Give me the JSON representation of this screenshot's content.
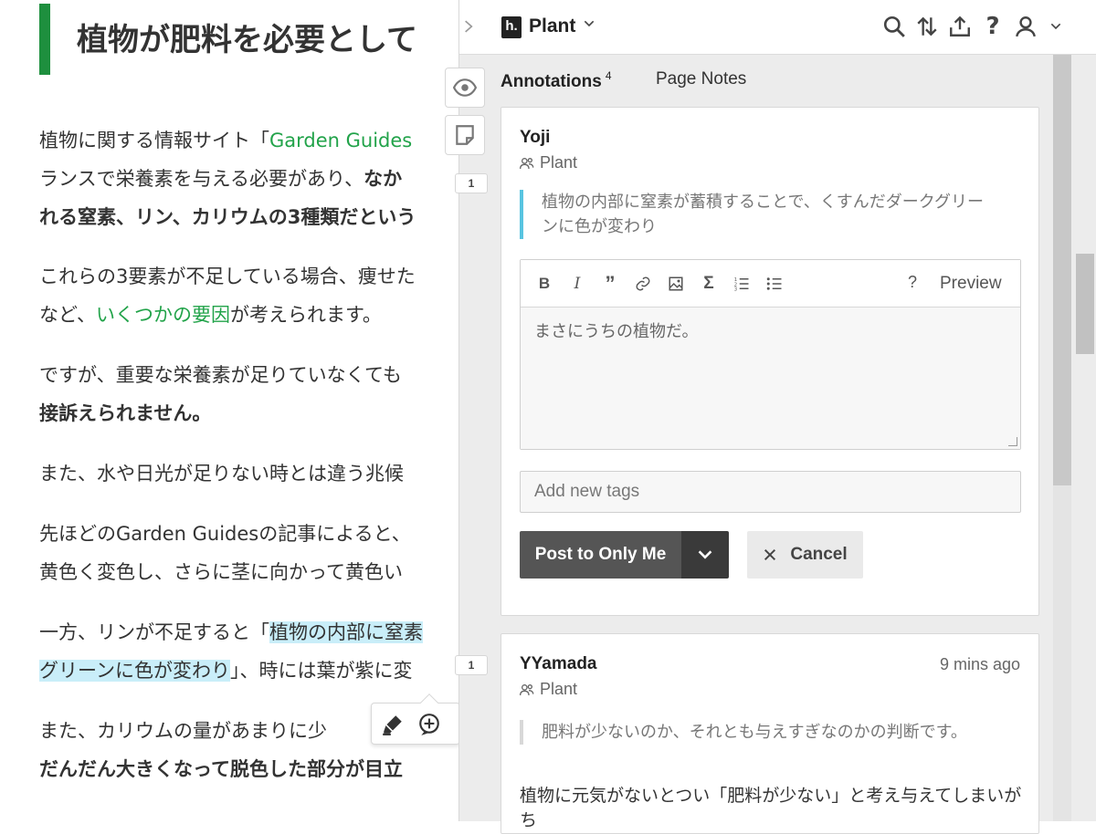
{
  "article": {
    "title": "植物が肥料を必要として",
    "p1_a": "植物に関する情報サイト「",
    "p1_link": "Garden Guides",
    "p1_b": "ランスで栄養素を与える必要があり、",
    "p1_c": "なか",
    "p1_d": "れる窒素、リン、カリウムの3種類だという",
    "p2_a": "これらの3要素が不足している場合、痩せた",
    "p2_b": "など、",
    "p2_link": "いくつかの要因",
    "p2_c": "が考えられます。",
    "p3_a": "ですが、重要な栄養素が足りていなくても",
    "p3_b": "接訴えられません。",
    "p4": "また、水や日光が足りない時とは違う兆候",
    "p5_a": "先ほどのGarden Guidesの記事によると、",
    "p5_b": "黄色く変色し、さらに茎に向かって黄色い",
    "p6_a": "一方、リンが不足すると「",
    "p6_hl1": "植物の内部に窒素",
    "p6_hl2": "グリーンに色が変わり",
    "p6_b": "」、時には葉が紫に変",
    "p7_a": "また、カリウムの量があまりに少",
    "p7_b": "だんだん大きくなって脱色した部分が目立"
  },
  "sidebar": {
    "group_name": "Plant",
    "logo_text": "h.",
    "tabs": {
      "annotations": "Annotations",
      "annotations_count": "4",
      "page_notes": "Page Notes"
    },
    "bucket_counts": [
      "1",
      "1"
    ]
  },
  "cards": [
    {
      "user": "Yoji",
      "group": "Plant",
      "quote": "植物の内部に窒素が蓄積することで、くすんだダークグリーンに色が変わり",
      "quote_color": "#58c4e0",
      "editor": {
        "text": "まさにうちの植物だ。",
        "help": "?",
        "preview": "Preview"
      },
      "tags_placeholder": "Add new tags",
      "post_label": "Post to Only Me",
      "cancel_label": "Cancel"
    },
    {
      "user": "YYamada",
      "timestamp": "9 mins ago",
      "group": "Plant",
      "quote": "肥料が少ないのか、それとも与えすぎなのかの判断です。",
      "quote_color": "#d8d8d8",
      "body": "植物に元気がないとつい「肥料が少ない」と考え与えてしまいがち"
    }
  ],
  "colors": {
    "accent_green": "#1e8f3e",
    "link_green": "#22a34a",
    "highlight": "#c9eef9",
    "post_button": "#555555"
  }
}
